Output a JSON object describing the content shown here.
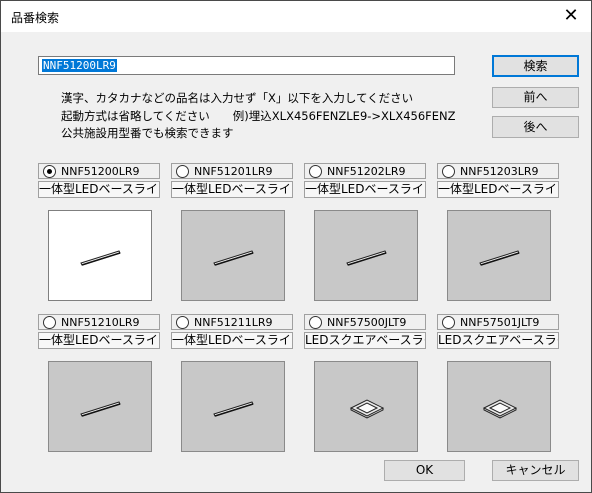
{
  "window": {
    "title": "品番検索",
    "close_glyph": "✕"
  },
  "search": {
    "value": "NNF51200LR9"
  },
  "buttons": {
    "search": "検索",
    "prev": "前へ",
    "next": "後へ",
    "ok": "OK",
    "cancel": "キャンセル"
  },
  "info": {
    "line1": "漢字、カタカナなどの品名は入力せず「X」以下を入力してください",
    "line2": "起動方式は省略してください　　例)埋込XLX456FENZLE9->XLX456FENZ",
    "line3": "公共施設用型番でも検索できます"
  },
  "products": [
    {
      "code": "NNF51200LR9",
      "name": "一体型LEDベースライト",
      "selected": true,
      "icon": "linear-light-icon"
    },
    {
      "code": "NNF51201LR9",
      "name": "一体型LEDベースライト",
      "selected": false,
      "icon": "linear-light-icon"
    },
    {
      "code": "NNF51202LR9",
      "name": "一体型LEDベースライト",
      "selected": false,
      "icon": "linear-light-icon"
    },
    {
      "code": "NNF51203LR9",
      "name": "一体型LEDベースライト",
      "selected": false,
      "icon": "linear-light-icon"
    },
    {
      "code": "NNF51210LR9",
      "name": "一体型LEDベースライト",
      "selected": false,
      "icon": "linear-light-icon"
    },
    {
      "code": "NNF51211LR9",
      "name": "一体型LEDベースライト",
      "selected": false,
      "icon": "linear-light-icon"
    },
    {
      "code": "NNF57500JLT9",
      "name": "LEDスクエアベースライ",
      "selected": false,
      "icon": "square-light-icon"
    },
    {
      "code": "NNF57501JLT9",
      "name": "LEDスクエアベースライ",
      "selected": false,
      "icon": "square-light-icon"
    }
  ]
}
